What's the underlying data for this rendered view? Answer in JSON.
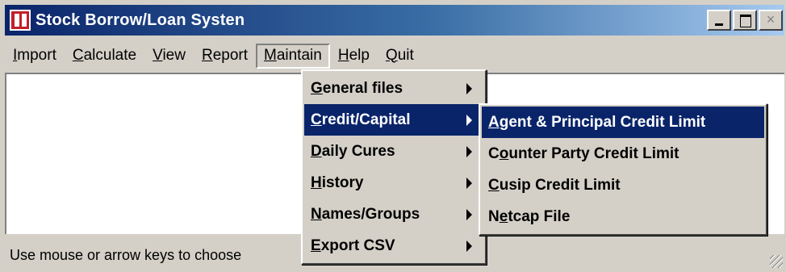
{
  "window": {
    "title": "Stock Borrow/Loan Systen",
    "controls": {
      "minimize": "_",
      "maximize": "□",
      "close": "×"
    }
  },
  "menubar": {
    "items": [
      {
        "pre": "",
        "u": "I",
        "post": "mport"
      },
      {
        "pre": "",
        "u": "C",
        "post": "alculate"
      },
      {
        "pre": "",
        "u": "V",
        "post": "iew"
      },
      {
        "pre": "",
        "u": "R",
        "post": "eport"
      },
      {
        "pre": "",
        "u": "M",
        "post": "aintain"
      },
      {
        "pre": "",
        "u": "H",
        "post": "elp"
      },
      {
        "pre": "",
        "u": "Q",
        "post": "uit"
      }
    ]
  },
  "maintain_menu": {
    "items": [
      {
        "pre": "",
        "u": "G",
        "post": "eneral files",
        "has_submenu": true
      },
      {
        "pre": "",
        "u": "C",
        "post": "redit/Capital",
        "has_submenu": true,
        "active": true
      },
      {
        "pre": "",
        "u": "D",
        "post": "aily Cures",
        "has_submenu": true
      },
      {
        "pre": "",
        "u": "H",
        "post": "istory",
        "has_submenu": true
      },
      {
        "pre": "",
        "u": "N",
        "post": "ames/Groups",
        "has_submenu": true
      },
      {
        "pre": "",
        "u": "E",
        "post": "xport CSV",
        "has_submenu": true
      }
    ]
  },
  "credit_submenu": {
    "items": [
      {
        "pre": "",
        "u": "A",
        "post": "gent & Principal Credit Limit",
        "active": true
      },
      {
        "pre": "C",
        "u": "o",
        "post": "unter Party Credit Limit"
      },
      {
        "pre": "",
        "u": "C",
        "post": "usip Credit Limit"
      },
      {
        "pre": "N",
        "u": "e",
        "post": "tcap File"
      }
    ]
  },
  "statusbar": {
    "text": "Use mouse or arrow keys to choose"
  },
  "colors": {
    "titlebar_start": "#0a246a",
    "titlebar_end": "#a6caf0",
    "highlight": "#0a246a",
    "face": "#d4d0c8"
  }
}
